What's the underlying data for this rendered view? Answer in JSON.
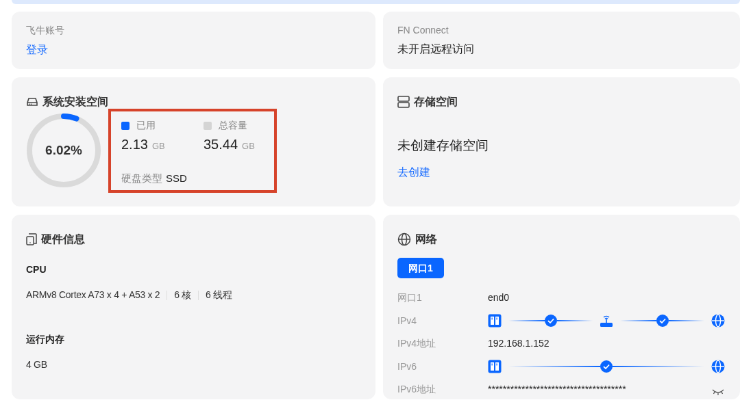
{
  "account": {
    "label": "飞牛账号",
    "link": "登录"
  },
  "fn_connect": {
    "label": "FN Connect",
    "value": "未开启远程访问"
  },
  "system_space": {
    "title": "系统安装空间",
    "level": 0.0602,
    "percent": "6.02%",
    "highlighted": true,
    "used": {
      "label": "已用",
      "value": "2.13",
      "unit": "GB",
      "color": "#0a66ff"
    },
    "total": {
      "label": "总容量",
      "value": "35.44",
      "unit": "GB",
      "color": "#d4d4d4"
    },
    "disk_type": {
      "label": "硬盘类型",
      "value": "SSD"
    }
  },
  "storage": {
    "title": "存储空间",
    "message": "未创建存储空间",
    "link": "去创建"
  },
  "hardware": {
    "title": "硬件信息",
    "sections": [
      {
        "heading": "CPU",
        "parts": [
          "ARMv8 Cortex A73 x 4 + A53 x 2",
          "6 核",
          "6 线程"
        ]
      },
      {
        "heading": "运行内存",
        "parts": [
          "4 GB"
        ]
      }
    ]
  },
  "network": {
    "title": "网络",
    "tabs": [
      {
        "label": "网口1",
        "selected": true
      }
    ],
    "rows": [
      {
        "kind": "text",
        "label": "网口1",
        "value": "end0"
      },
      {
        "kind": "path",
        "label": "IPv4",
        "nodes": [
          {
            "kind": "nas",
            "connected": true
          },
          {
            "kind": "router",
            "connected": true
          },
          {
            "kind": "internet"
          }
        ]
      },
      {
        "kind": "text",
        "label": "IPv4地址",
        "value": "192.168.1.152"
      },
      {
        "kind": "path",
        "label": "IPv6",
        "nodes": [
          {
            "kind": "nas",
            "connected": true
          },
          {
            "kind": "internet"
          }
        ]
      },
      {
        "kind": "secret",
        "label": "IPv6地址",
        "value": "*************************************"
      }
    ]
  }
}
